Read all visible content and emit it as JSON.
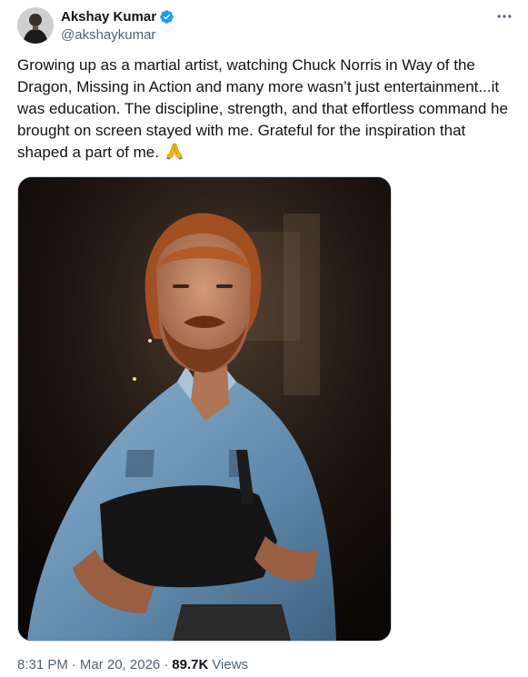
{
  "author": {
    "display_name": "Akshay Kumar",
    "handle": "@akshaykumar",
    "verified": true
  },
  "tweet": {
    "text_lines": [
      "Growing up as a martial artist, watching Chuck Norris in Way of the",
      "Dragon, Missing in Action and many more wasn’t just entertainment...it",
      "was education. The discipline, strength, and that effortless command he",
      "brought on screen stayed with me. Grateful for the inspiration that",
      "shaped a part of me."
    ],
    "emoji": "🙏",
    "time": "8:31 PM",
    "separator": "·",
    "date": "Mar 20, 2026",
    "views_count": "89.7K",
    "views_label": "Views"
  },
  "colors": {
    "verified_badge": "#1d9bf0",
    "secondary_text": "#536471",
    "primary_text": "#0f1419",
    "emoji_hands": "#f4b400"
  },
  "icons": {
    "verified": "verified-badge-icon",
    "more": "more-horizontal-icon"
  }
}
